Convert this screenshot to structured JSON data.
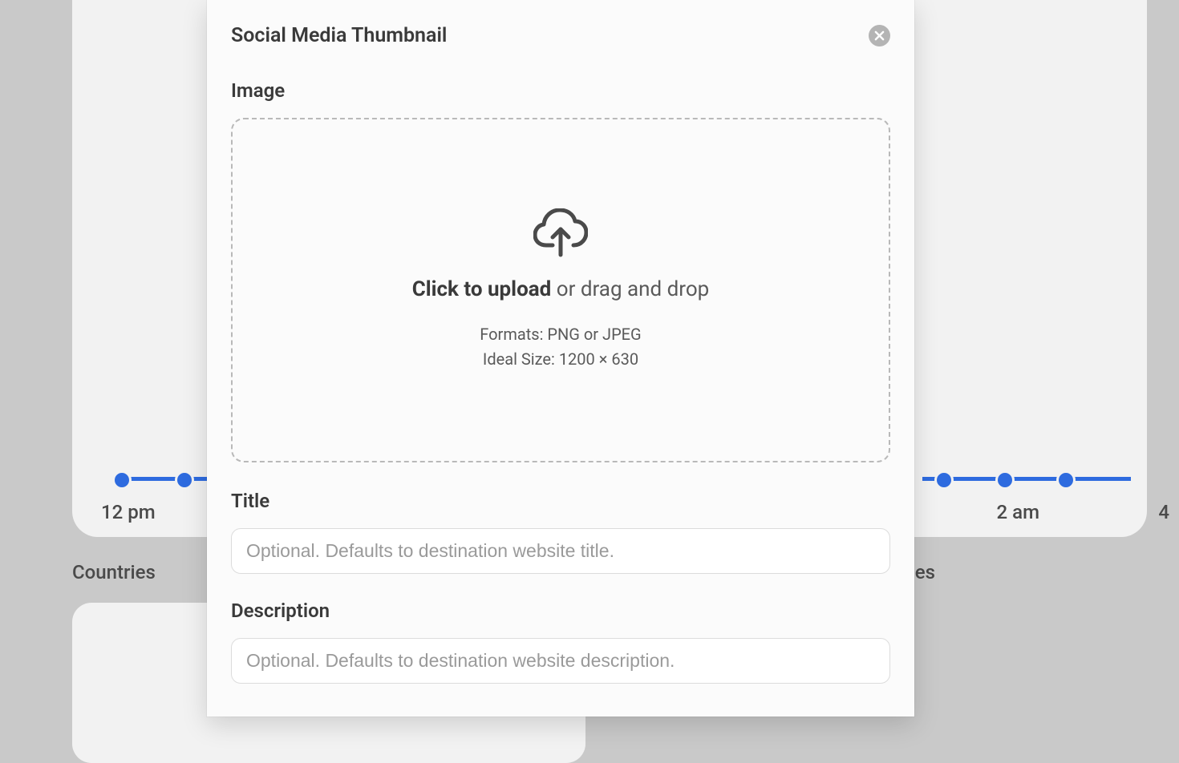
{
  "background": {
    "axis_labels": {
      "left": "12 pm",
      "right1": "2 am",
      "right2": "4"
    },
    "countries_label": "Countries",
    "right_fragment": "es"
  },
  "modal": {
    "title": "Social Media Thumbnail",
    "image_section": {
      "label": "Image",
      "upload_bold": "Click to upload",
      "upload_rest": " or drag and drop",
      "formats_line": "Formats: PNG or JPEG",
      "size_line": "Ideal Size: 1200 × 630"
    },
    "title_section": {
      "label": "Title",
      "placeholder": "Optional. Defaults to destination website title."
    },
    "description_section": {
      "label": "Description",
      "placeholder": "Optional. Defaults to destination website description."
    }
  }
}
